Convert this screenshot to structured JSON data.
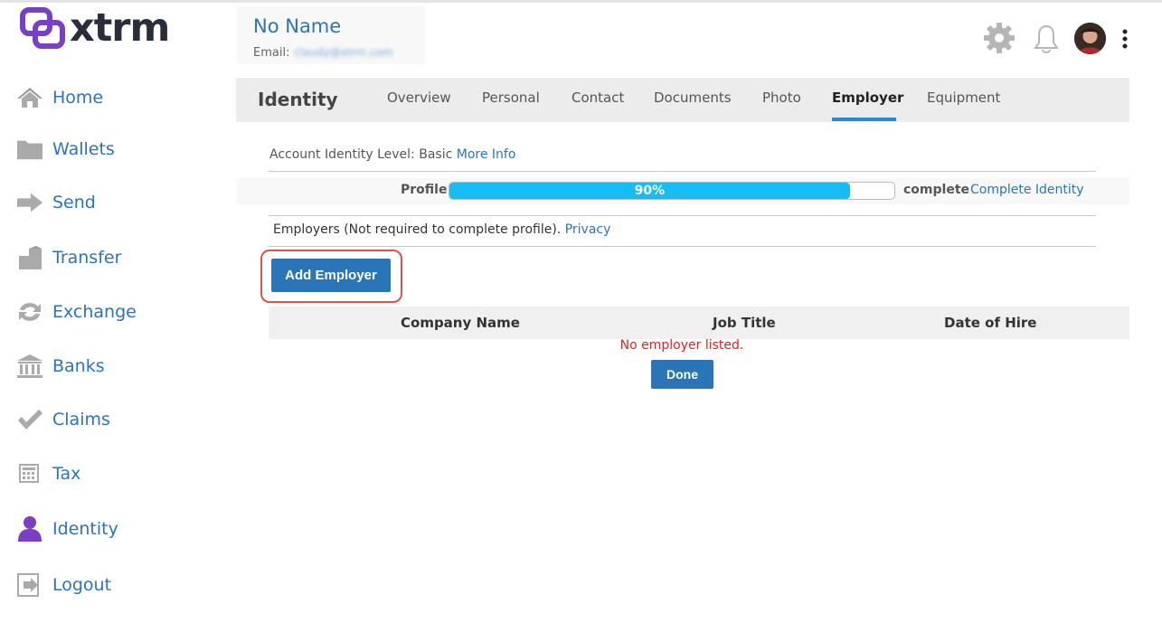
{
  "app": {
    "logo_text": "xtrm",
    "brand_color": "#7b3fc4"
  },
  "sidebar": {
    "items": [
      {
        "label": "Home",
        "icon": "home-icon"
      },
      {
        "label": "Wallets",
        "icon": "folder-icon"
      },
      {
        "label": "Send",
        "icon": "arrow-right-icon"
      },
      {
        "label": "Transfer",
        "icon": "transfer-icon"
      },
      {
        "label": "Exchange",
        "icon": "exchange-icon"
      },
      {
        "label": "Banks",
        "icon": "bank-icon"
      },
      {
        "label": "Claims",
        "icon": "checkmark-icon"
      },
      {
        "label": "Tax",
        "icon": "calculator-icon"
      },
      {
        "label": "Identity",
        "icon": "user-icon"
      },
      {
        "label": "Logout",
        "icon": "logout-icon"
      }
    ]
  },
  "user": {
    "name": "No Name",
    "email_label": "Email:",
    "email_value": "claudy@xtrm.com"
  },
  "header_icons": [
    "gear-icon",
    "bell-icon",
    "avatar",
    "more-vertical-icon"
  ],
  "tabs": {
    "title": "Identity",
    "items": [
      {
        "label": "Overview"
      },
      {
        "label": "Personal"
      },
      {
        "label": "Contact"
      },
      {
        "label": "Documents"
      },
      {
        "label": "Photo"
      },
      {
        "label": "Employer"
      },
      {
        "label": "Equipment"
      }
    ],
    "active": "Employer"
  },
  "identity": {
    "level_label": "Account Identity Level:",
    "level_value": "Basic",
    "more_info": "More Info"
  },
  "profile": {
    "label": "Profile",
    "progress": 0.9,
    "progress_text": "90%",
    "complete_text": "complete",
    "complete_link": "Complete Identity",
    "progress_color": "#17bdf2"
  },
  "employers": {
    "note": "Employers (Not required to complete profile).",
    "privacy_link": "Privacy",
    "add_button": "Add Employer",
    "columns": [
      "Company Name",
      "Job Title",
      "Date of Hire"
    ],
    "empty_message": "No employer listed.",
    "done_button": "Done"
  }
}
